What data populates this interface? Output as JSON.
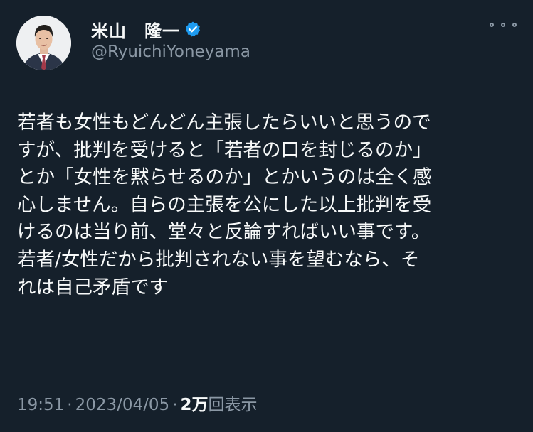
{
  "author": {
    "display_name": "米山　隆一",
    "handle": "@RyuichiYoneyama",
    "verified_color": "#1d9bf0"
  },
  "more_icon": "more-horizontal-icon",
  "tweet": {
    "lines": [
      "若者も女性もどんどん主張したらいいと思うので",
      "すが、批判を受けると「若者の口を封じるのか」",
      "とか「女性を黙らせるのか」とかいうのは全く感",
      "心しません。自らの主張を公にした以上批判を受",
      "けるのは当り前、堂々と反論すればいい事です。",
      "若者/女性だから批判されない事を望むなら、そ",
      "れは自己矛盾です"
    ]
  },
  "meta": {
    "time": "19:51",
    "separator": "·",
    "date": "2023/04/05",
    "views_count": "2万",
    "views_label": "回表示"
  }
}
